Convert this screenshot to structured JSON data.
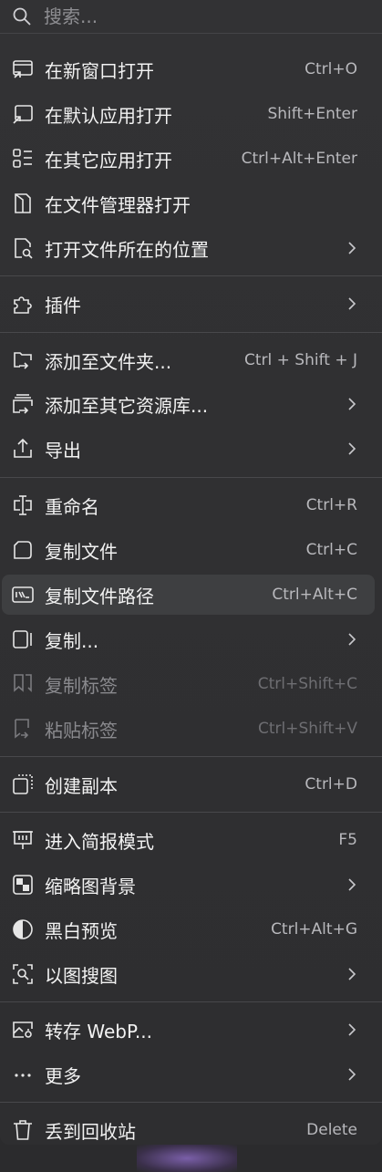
{
  "search": {
    "placeholder": "搜索..."
  },
  "items": [
    {
      "label": "在新窗口打开",
      "shortcut": "Ctrl+O",
      "icon": "new-window-icon"
    },
    {
      "label": "在默认应用打开",
      "shortcut": "Shift+Enter",
      "icon": "open-default-app-icon"
    },
    {
      "label": "在其它应用打开",
      "shortcut": "Ctrl+Alt+Enter",
      "icon": "app-list-icon"
    },
    {
      "label": "在文件管理器打开",
      "shortcut": "",
      "icon": "file-manager-icon"
    },
    {
      "label": "打开文件所在的位置",
      "shortcut": "",
      "icon": "file-search-icon",
      "submenu": true
    },
    {
      "label": "插件",
      "shortcut": "",
      "icon": "puzzle-icon",
      "submenu": true
    },
    {
      "label": "添加至文件夹...",
      "shortcut": "Ctrl + Shift + J",
      "icon": "add-to-folder-icon"
    },
    {
      "label": "添加至其它资源库...",
      "shortcut": "",
      "icon": "add-to-library-icon",
      "submenu": true
    },
    {
      "label": "导出",
      "shortcut": "",
      "icon": "export-icon",
      "submenu": true
    },
    {
      "label": "重命名",
      "shortcut": "Ctrl+R",
      "icon": "rename-icon"
    },
    {
      "label": "复制文件",
      "shortcut": "Ctrl+C",
      "icon": "copy-file-icon"
    },
    {
      "label": "复制文件路径",
      "shortcut": "Ctrl+Alt+C",
      "icon": "copy-path-icon",
      "highlighted": true
    },
    {
      "label": "复制...",
      "shortcut": "",
      "icon": "copy-more-icon",
      "submenu": true
    },
    {
      "label": "复制标签",
      "shortcut": "Ctrl+Shift+C",
      "icon": "copy-tags-icon",
      "disabled": true
    },
    {
      "label": "粘贴标签",
      "shortcut": "Ctrl+Shift+V",
      "icon": "paste-tags-icon",
      "disabled": true
    },
    {
      "label": "创建副本",
      "shortcut": "Ctrl+D",
      "icon": "duplicate-icon"
    },
    {
      "label": "进入简报模式",
      "shortcut": "F5",
      "icon": "presentation-icon"
    },
    {
      "label": "缩略图背景",
      "shortcut": "",
      "icon": "checkerboard-icon",
      "submenu": true
    },
    {
      "label": "黑白预览",
      "shortcut": "Ctrl+Alt+G",
      "icon": "grayscale-icon"
    },
    {
      "label": "以图搜图",
      "shortcut": "",
      "icon": "image-search-icon",
      "submenu": true
    },
    {
      "label": "转存 WebP...",
      "shortcut": "",
      "icon": "convert-image-icon",
      "submenu": true
    },
    {
      "label": "更多",
      "shortcut": "",
      "icon": "more-icon",
      "submenu": true
    },
    {
      "label": "丢到回收站",
      "shortcut": "Delete",
      "icon": "trash-icon"
    }
  ]
}
